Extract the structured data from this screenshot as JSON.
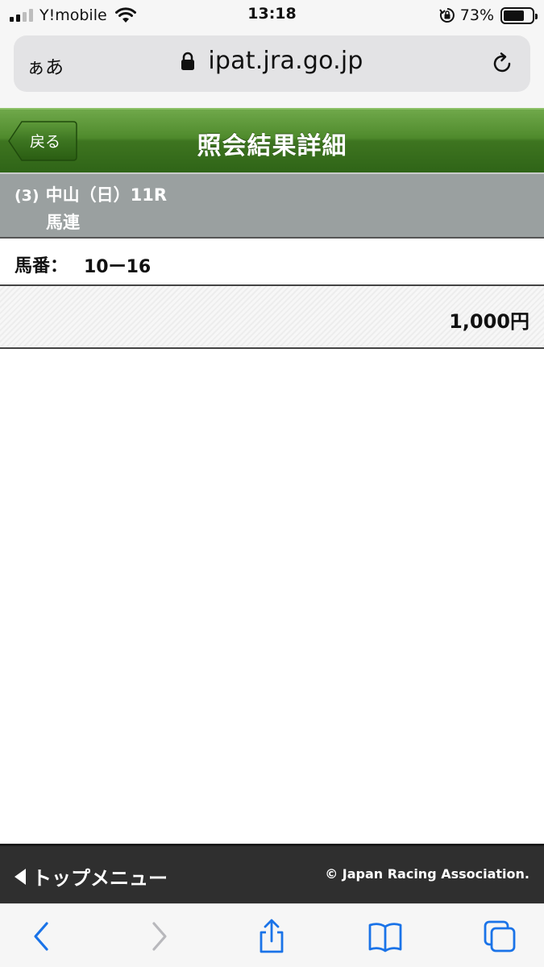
{
  "status_bar": {
    "carrier": "Y!mobile",
    "time": "13:18",
    "battery_percent": "73%",
    "battery_level": 0.73,
    "signal_bars": 2
  },
  "browser": {
    "text_size_button": "ぁあ",
    "url": "ipat.jra.go.jp"
  },
  "header": {
    "back_label": "戻る",
    "title": "照会結果詳細",
    "accent_color": "#3e7520"
  },
  "race": {
    "number": "(3)",
    "name": "中山（日）11R",
    "bet_type": "馬連"
  },
  "horse": {
    "label": "馬番：",
    "value": "10ー16"
  },
  "amount": "1,000円",
  "footer": {
    "top_menu": "トップメニュー",
    "copyright": "© Japan Racing Association."
  },
  "toolbar": {
    "icons": [
      "back-icon",
      "forward-icon",
      "share-icon",
      "bookmarks-icon",
      "tabs-icon"
    ],
    "accent_color": "#1a73e8"
  }
}
